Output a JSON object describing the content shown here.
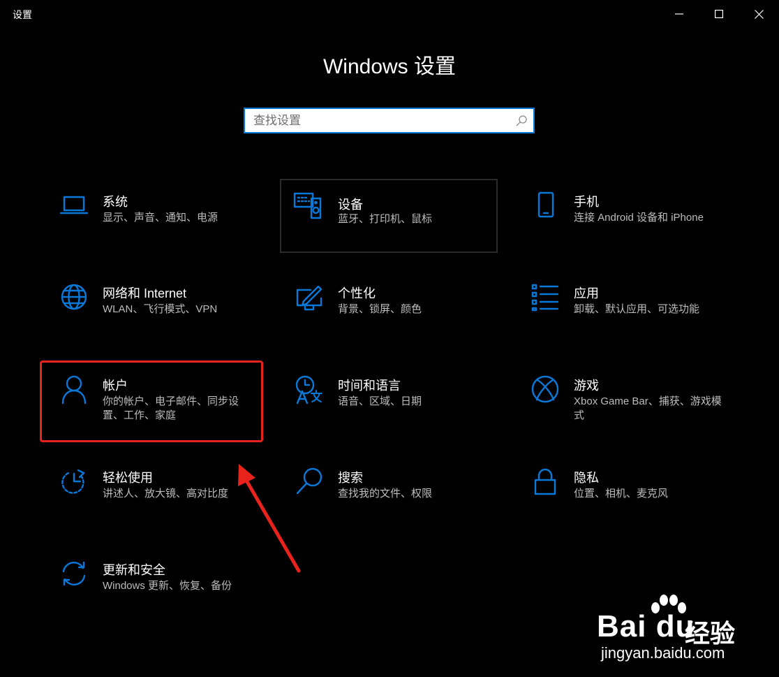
{
  "window": {
    "title": "设置"
  },
  "header": {
    "title": "Windows 设置"
  },
  "search": {
    "placeholder": "查找设置",
    "value": ""
  },
  "tiles": [
    {
      "name": "系统",
      "desc": "显示、声音、通知、电源",
      "icon": "laptop-icon"
    },
    {
      "name": "设备",
      "desc": "蓝牙、打印机、鼠标",
      "icon": "keyboard-speaker-icon"
    },
    {
      "name": "手机",
      "desc": "连接 Android 设备和 iPhone",
      "icon": "phone-icon"
    },
    {
      "name": "网络和 Internet",
      "desc": "WLAN、飞行模式、VPN",
      "icon": "globe-icon"
    },
    {
      "name": "个性化",
      "desc": "背景、锁屏、颜色",
      "icon": "paint-icon"
    },
    {
      "name": "应用",
      "desc": "卸载、默认应用、可选功能",
      "icon": "apps-list-icon"
    },
    {
      "name": "帐户",
      "desc": "你的帐户、电子邮件、同步设置、工作、家庭",
      "icon": "person-icon"
    },
    {
      "name": "时间和语言",
      "desc": "语音、区域、日期",
      "icon": "time-language-icon"
    },
    {
      "name": "游戏",
      "desc": "Xbox Game Bar、捕获、游戏模式",
      "icon": "xbox-icon"
    },
    {
      "name": "轻松使用",
      "desc": "讲述人、放大镜、高对比度",
      "icon": "ease-of-access-icon"
    },
    {
      "name": "搜索",
      "desc": "查找我的文件、权限",
      "icon": "magnifier-icon"
    },
    {
      "name": "隐私",
      "desc": "位置、相机、麦克风",
      "icon": "lock-icon"
    },
    {
      "name": "更新和安全",
      "desc": "Windows 更新、恢复、备份",
      "icon": "sync-icon"
    }
  ],
  "watermark": {
    "logo": "Bai du",
    "cn": "经验",
    "url": "jingyan.baidu.com"
  },
  "colors": {
    "accent": "#0a78d6",
    "highlight": "#e8231c",
    "background": "#000000"
  }
}
